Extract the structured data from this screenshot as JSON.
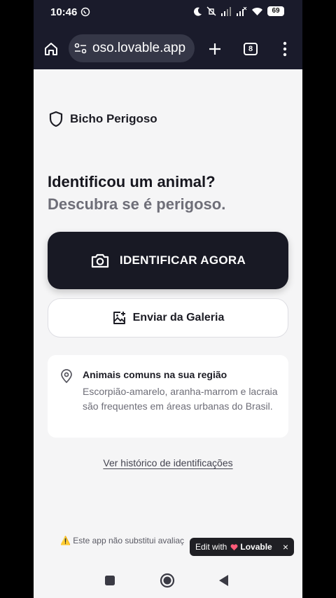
{
  "status_bar": {
    "time": "10:46",
    "battery": "69"
  },
  "browser": {
    "url": "oso.lovable.app",
    "tab_count": "8"
  },
  "app": {
    "brand": "Bicho Perigoso",
    "headline": "Identificou um animal?",
    "subheadline": "Descubra se é perigoso.",
    "primary_button": "IDENTIFICAR AGORA",
    "secondary_button": "Enviar da Galeria",
    "info_card": {
      "title": "Animais comuns na sua região",
      "text": "Escorpião-amarelo, aranha-marrom e lacraia são frequentes em áreas urbanas do Brasil."
    },
    "history_link": "Ver histórico de identificações",
    "disclaimer": "⚠️ Este app não substitui avaliaç"
  },
  "lovable_badge": {
    "prefix": "Edit with",
    "brand": "Lovable",
    "close": "×"
  },
  "colors": {
    "primary": "#181924",
    "background": "#f5f5f6",
    "browser_chrome": "#1a1b2b",
    "accent_lovable": "#ff5a78"
  }
}
